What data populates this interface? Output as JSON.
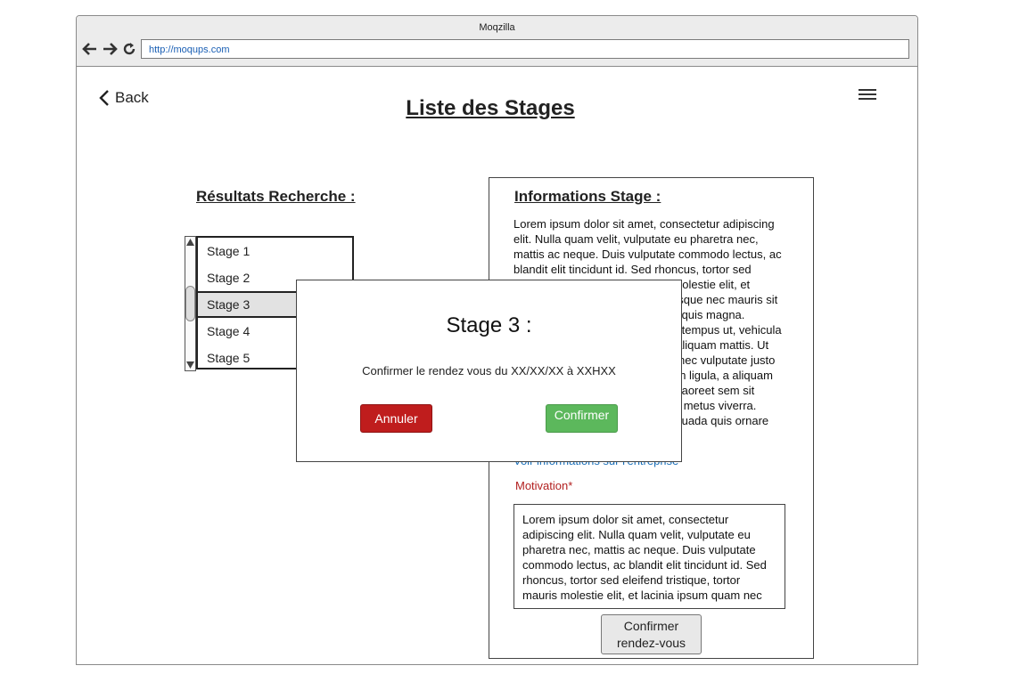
{
  "browser": {
    "title": "Moqzilla",
    "url": "http://moqups.com"
  },
  "header": {
    "back_label": "Back",
    "page_title": "Liste des Stages"
  },
  "results": {
    "title": "Résultats Recherche :",
    "items": [
      {
        "label": "Stage 1"
      },
      {
        "label": "Stage 2"
      },
      {
        "label": "Stage 3",
        "selected": true
      },
      {
        "label": "Stage 4"
      },
      {
        "label": "Stage 5"
      }
    ]
  },
  "info": {
    "title": "Informations Stage :",
    "lines": [
      "Lorem ipsum dolor sit amet, consectetur adipiscing",
      "elit. Nulla quam velit, vulputate eu pharetra nec,",
      "mattis ac neque. Duis vulputate commodo lectus, ac",
      "blandit elit tincidunt id. Sed rhoncus, tortor sed",
      "eleifend tristique, tortor mauris molestie elit, et",
      "lacinia ipsum quam nec dui. Quisque nec mauris sit",
      "amet elit iaculis pretium sit amet quis magna.",
      "Aenean velit odio, elementum in tempus ut, vehicula",
      "eu diam. Pellentesque rhoncus aliquam mattis. Ut",
      "vulputate eros sed felis sodales nec vulputate justo",
      "hendrerit. Vivamus varius pretium ligula, a aliquam",
      "odio euismod sit amet. Quisque laoreet sem sit",
      "amet orci ullamcorper at ultricies metus viverra.",
      "Pellentesque arcu mauris, malesuada quis ornare"
    ],
    "company_link": "Voir informations sur l'entreprise",
    "motivation_label": "Motivation*",
    "motivation_lines": [
      "Lorem ipsum dolor sit amet, consectetur",
      "adipiscing elit. Nulla quam velit, vulputate eu",
      "pharetra nec, mattis ac neque. Duis vulputate",
      "commodo lectus, ac blandit elit tincidunt id. Sed",
      "rhoncus, tortor sed eleifend tristique, tortor",
      "mauris molestie elit, et lacinia ipsum quam nec"
    ],
    "confirm_line1": "Confirmer",
    "confirm_line2": "rendez-vous"
  },
  "modal": {
    "title": "Stage 3 :",
    "message": "Confirmer le rendez vous du XX/XX/XX à XXHXX",
    "cancel_label": "Annuler",
    "confirm_label": "Confirmer"
  }
}
